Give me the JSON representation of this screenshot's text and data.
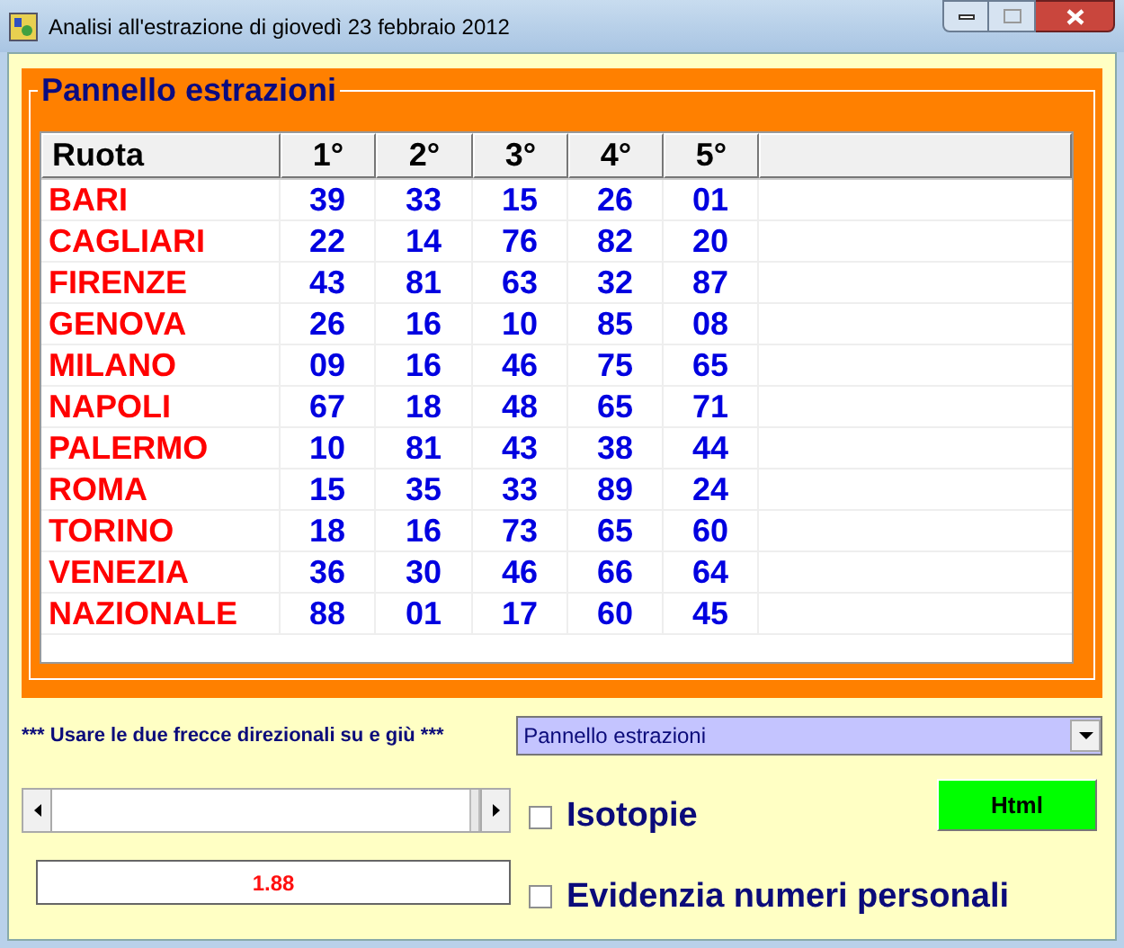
{
  "window": {
    "title": "Analisi all'estrazione di giovedì 23 febbraio 2012"
  },
  "panel": {
    "title": "Pannello estrazioni",
    "table": {
      "columns": [
        "Ruota",
        "1°",
        "2°",
        "3°",
        "4°",
        "5°"
      ],
      "rows": [
        {
          "ruota": "BARI",
          "numbers": [
            "39",
            "33",
            "15",
            "26",
            "01"
          ]
        },
        {
          "ruota": "CAGLIARI",
          "numbers": [
            "22",
            "14",
            "76",
            "82",
            "20"
          ]
        },
        {
          "ruota": "FIRENZE",
          "numbers": [
            "43",
            "81",
            "63",
            "32",
            "87"
          ]
        },
        {
          "ruota": "GENOVA",
          "numbers": [
            "26",
            "16",
            "10",
            "85",
            "08"
          ]
        },
        {
          "ruota": "MILANO",
          "numbers": [
            "09",
            "16",
            "46",
            "75",
            "65"
          ]
        },
        {
          "ruota": "NAPOLI",
          "numbers": [
            "67",
            "18",
            "48",
            "65",
            "71"
          ]
        },
        {
          "ruota": "PALERMO",
          "numbers": [
            "10",
            "81",
            "43",
            "38",
            "44"
          ]
        },
        {
          "ruota": "ROMA",
          "numbers": [
            "15",
            "35",
            "33",
            "89",
            "24"
          ]
        },
        {
          "ruota": "TORINO",
          "numbers": [
            "18",
            "16",
            "73",
            "65",
            "60"
          ]
        },
        {
          "ruota": "VENEZIA",
          "numbers": [
            "36",
            "30",
            "46",
            "66",
            "64"
          ]
        },
        {
          "ruota": "NAZIONALE",
          "numbers": [
            "88",
            "01",
            "17",
            "60",
            "45"
          ]
        }
      ]
    }
  },
  "hint": "*** Usare le due frecce direzionali su e giù ***",
  "view_select": {
    "value": "Pannello estrazioni"
  },
  "scrollbar": {
    "level": 1
  },
  "value_field": {
    "value": "1.88"
  },
  "checkboxes": [
    {
      "label": "Isotopie",
      "checked": false
    },
    {
      "label": "Evidenzia numeri personali",
      "checked": false
    }
  ],
  "html_button": {
    "label": "Html"
  }
}
